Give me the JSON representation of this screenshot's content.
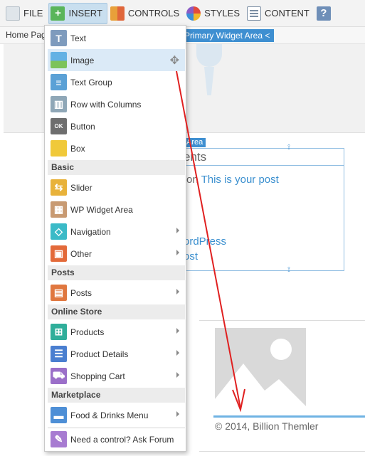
{
  "toolbar": {
    "file": "FILE",
    "insert": "INSERT",
    "controls": "CONTROLS",
    "styles": "STYLES",
    "content": "CONTENT",
    "help": "?"
  },
  "breadcrumb": {
    "home": "Home Pag",
    "area_tag": "Primary Widget Area <"
  },
  "page": {
    "widget_tag": "Area",
    "widget_title": "ents",
    "widget_text_prefix": "on",
    "widget_text_link": "This is your post",
    "widget_link2": "ordPress",
    "widget_link3": "ost",
    "footer_text": "© 2014, Billion Themler"
  },
  "menu": {
    "items_top": [
      {
        "label": "Text",
        "icon": "text-icon",
        "color": "#7e9bbd",
        "glyph": "T"
      },
      {
        "label": "Image",
        "icon": "image-icon",
        "color": "#63b1e4",
        "glyph": "▲"
      },
      {
        "label": "Text Group",
        "icon": "text-group-icon",
        "color": "#5ba1d6",
        "glyph": "≡"
      },
      {
        "label": "Row with Columns",
        "icon": "columns-icon",
        "color": "#8fa7b7",
        "glyph": "▥"
      },
      {
        "label": "Button",
        "icon": "button-icon",
        "color": "#6e6e6e",
        "glyph": "OK"
      },
      {
        "label": "Box",
        "icon": "box-icon",
        "color": "#f0c93a",
        "glyph": ""
      }
    ],
    "section_basic": "Basic",
    "items_basic": [
      {
        "label": "Slider",
        "icon": "slider-icon",
        "color": "#e8b23a",
        "glyph": "⇆"
      },
      {
        "label": "WP Widget Area",
        "icon": "widget-area-icon",
        "color": "#c89a72",
        "glyph": "▦"
      },
      {
        "label": "Navigation",
        "icon": "navigation-icon",
        "color": "#3bbac7",
        "glyph": "◇"
      },
      {
        "label": "Other",
        "icon": "other-icon",
        "color": "#e36a3a",
        "glyph": "▣"
      }
    ],
    "section_posts": "Posts",
    "items_posts": [
      {
        "label": "Posts",
        "icon": "posts-icon",
        "color": "#e0773f",
        "glyph": "▤"
      }
    ],
    "section_store": "Online Store",
    "items_store": [
      {
        "label": "Products",
        "icon": "products-icon",
        "color": "#2fae9a",
        "glyph": "⊞"
      },
      {
        "label": "Product Details",
        "icon": "product-details-icon",
        "color": "#4a7fd0",
        "glyph": "☰"
      },
      {
        "label": "Shopping Cart",
        "icon": "shopping-cart-icon",
        "color": "#9b6fc9",
        "glyph": "⛟"
      }
    ],
    "section_marketplace": "Marketplace",
    "items_marketplace": [
      {
        "label": "Food & Drinks Menu",
        "icon": "food-menu-icon",
        "color": "#4e8fd6",
        "glyph": "▬"
      }
    ],
    "forum": {
      "label": "Need a control? Ask Forum",
      "icon": "forum-icon",
      "color": "#a77bd1",
      "glyph": "✎"
    }
  },
  "colors": {
    "accent": "#3e8fd1",
    "hover": "#dbeaf7",
    "arrow": "#e02020"
  }
}
